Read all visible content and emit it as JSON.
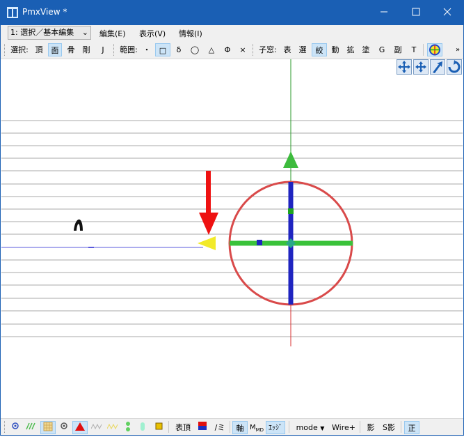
{
  "window": {
    "title": "PmxView *",
    "buttons": {
      "minimize": "—",
      "maximize": "☐",
      "close": "✕"
    }
  },
  "menubar": {
    "mode_select": "1: 選択／基本編集",
    "items": [
      "編集(E)",
      "表示(V)",
      "情報(I)"
    ]
  },
  "toolbar": {
    "select_label": "選択:",
    "select_buttons": [
      "頂",
      "面",
      "骨",
      "剛",
      "J"
    ],
    "range_label": "範囲:",
    "range_buttons": [
      "・",
      "□",
      "δ",
      "◯",
      "△",
      "Φ",
      "×"
    ],
    "subwindow_label": "子窓:",
    "subwindow_buttons": [
      "表",
      "選",
      "絞",
      "動",
      "拡",
      "塗",
      "G",
      "副",
      "T"
    ],
    "overflow": "»"
  },
  "statusbar": {
    "vertex_label": "表頂",
    "mirror_label": "/ミ",
    "axis_label": "軸",
    "mo_label": "M",
    "edge_label": "ｴｯｼﾞ",
    "mode_label": "mode",
    "wire_label": "Wire+",
    "shadow_label": "影",
    "sshadow_label": "S影",
    "ortho_label": "正"
  },
  "colors": {
    "titlebar": "#1a5fb4",
    "gizmo_ring": "#d94a4a",
    "gizmo_vertical": "#1f24c0",
    "gizmo_horizontal": "#3ac23a",
    "up_arrow": "#3dbb3d",
    "down_arrow": "#ee1111",
    "left_arrow": "#f2ea2a"
  }
}
